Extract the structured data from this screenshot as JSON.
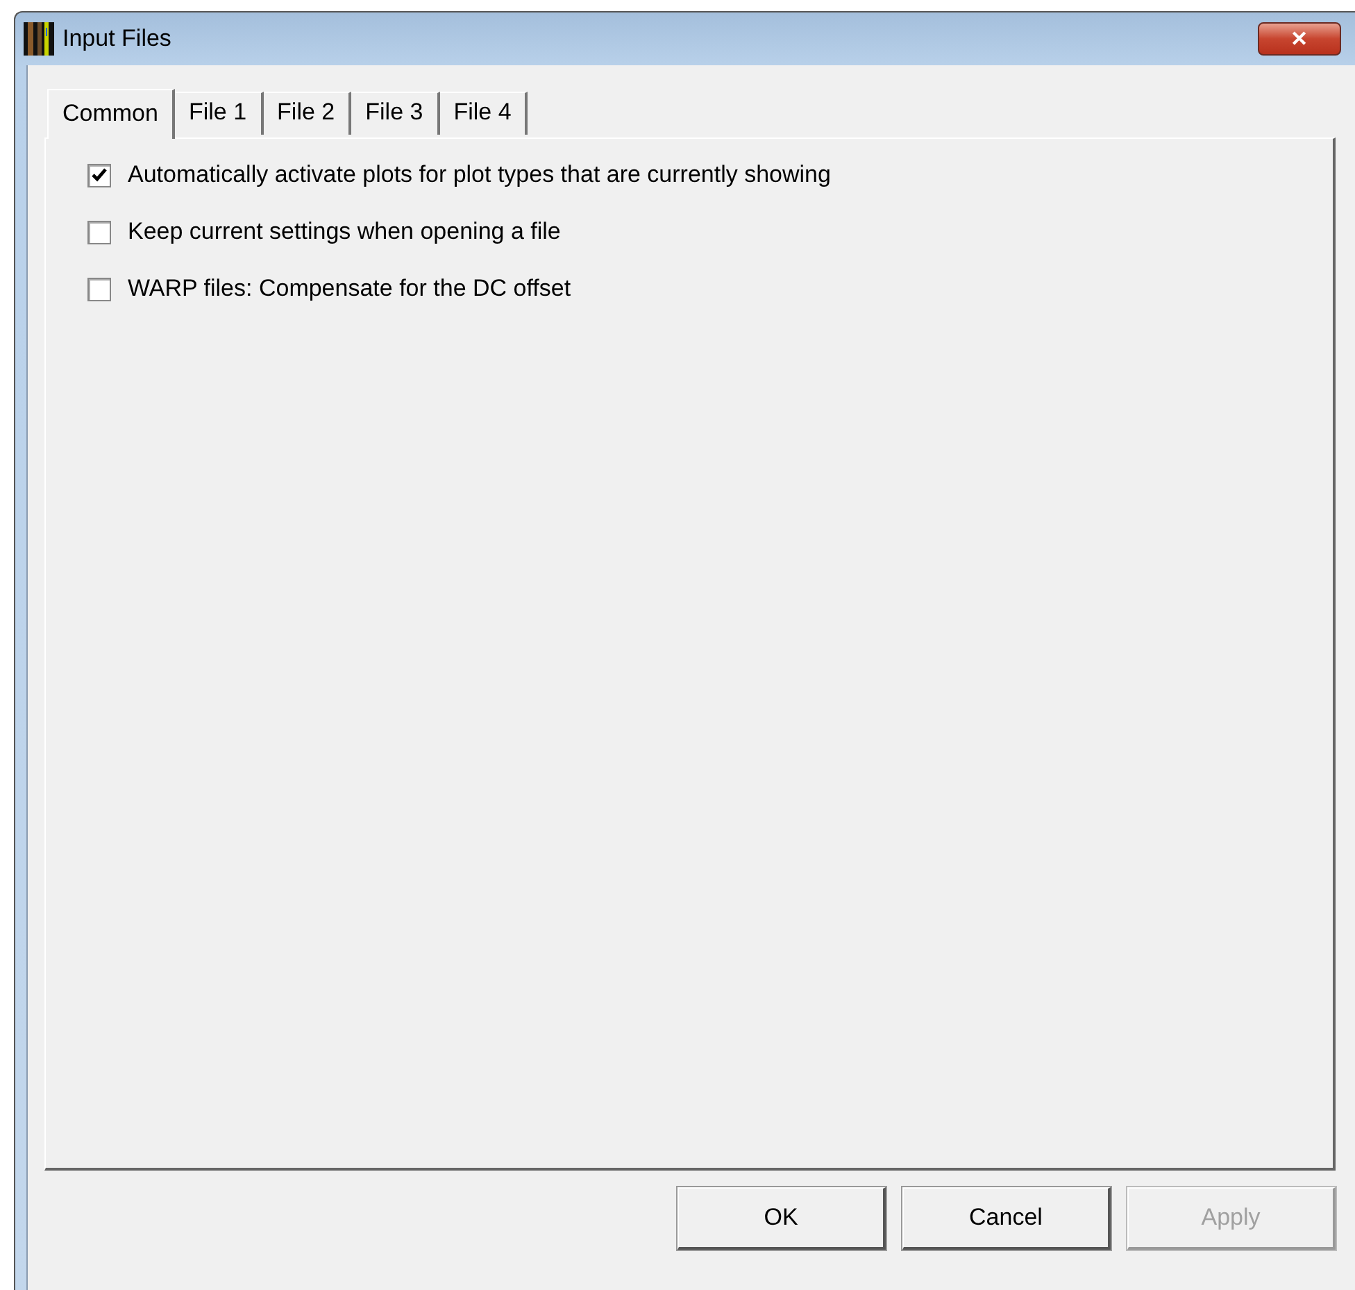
{
  "window": {
    "title": "Input Files",
    "close": "✕"
  },
  "tabs": [
    {
      "label": "Common",
      "selected": true
    },
    {
      "label": "File 1",
      "selected": false
    },
    {
      "label": "File 2",
      "selected": false
    },
    {
      "label": "File 3",
      "selected": false
    },
    {
      "label": "File 4",
      "selected": false
    }
  ],
  "options": [
    {
      "label": "Automatically activate plots for plot types that are currently showing",
      "checked": true
    },
    {
      "label": "Keep current settings when opening a file",
      "checked": false
    },
    {
      "label": "WARP files: Compensate for the DC offset",
      "checked": false
    }
  ],
  "buttons": [
    {
      "label": "OK",
      "disabled": false
    },
    {
      "label": "Cancel",
      "disabled": false
    },
    {
      "label": "Apply",
      "disabled": true
    }
  ]
}
